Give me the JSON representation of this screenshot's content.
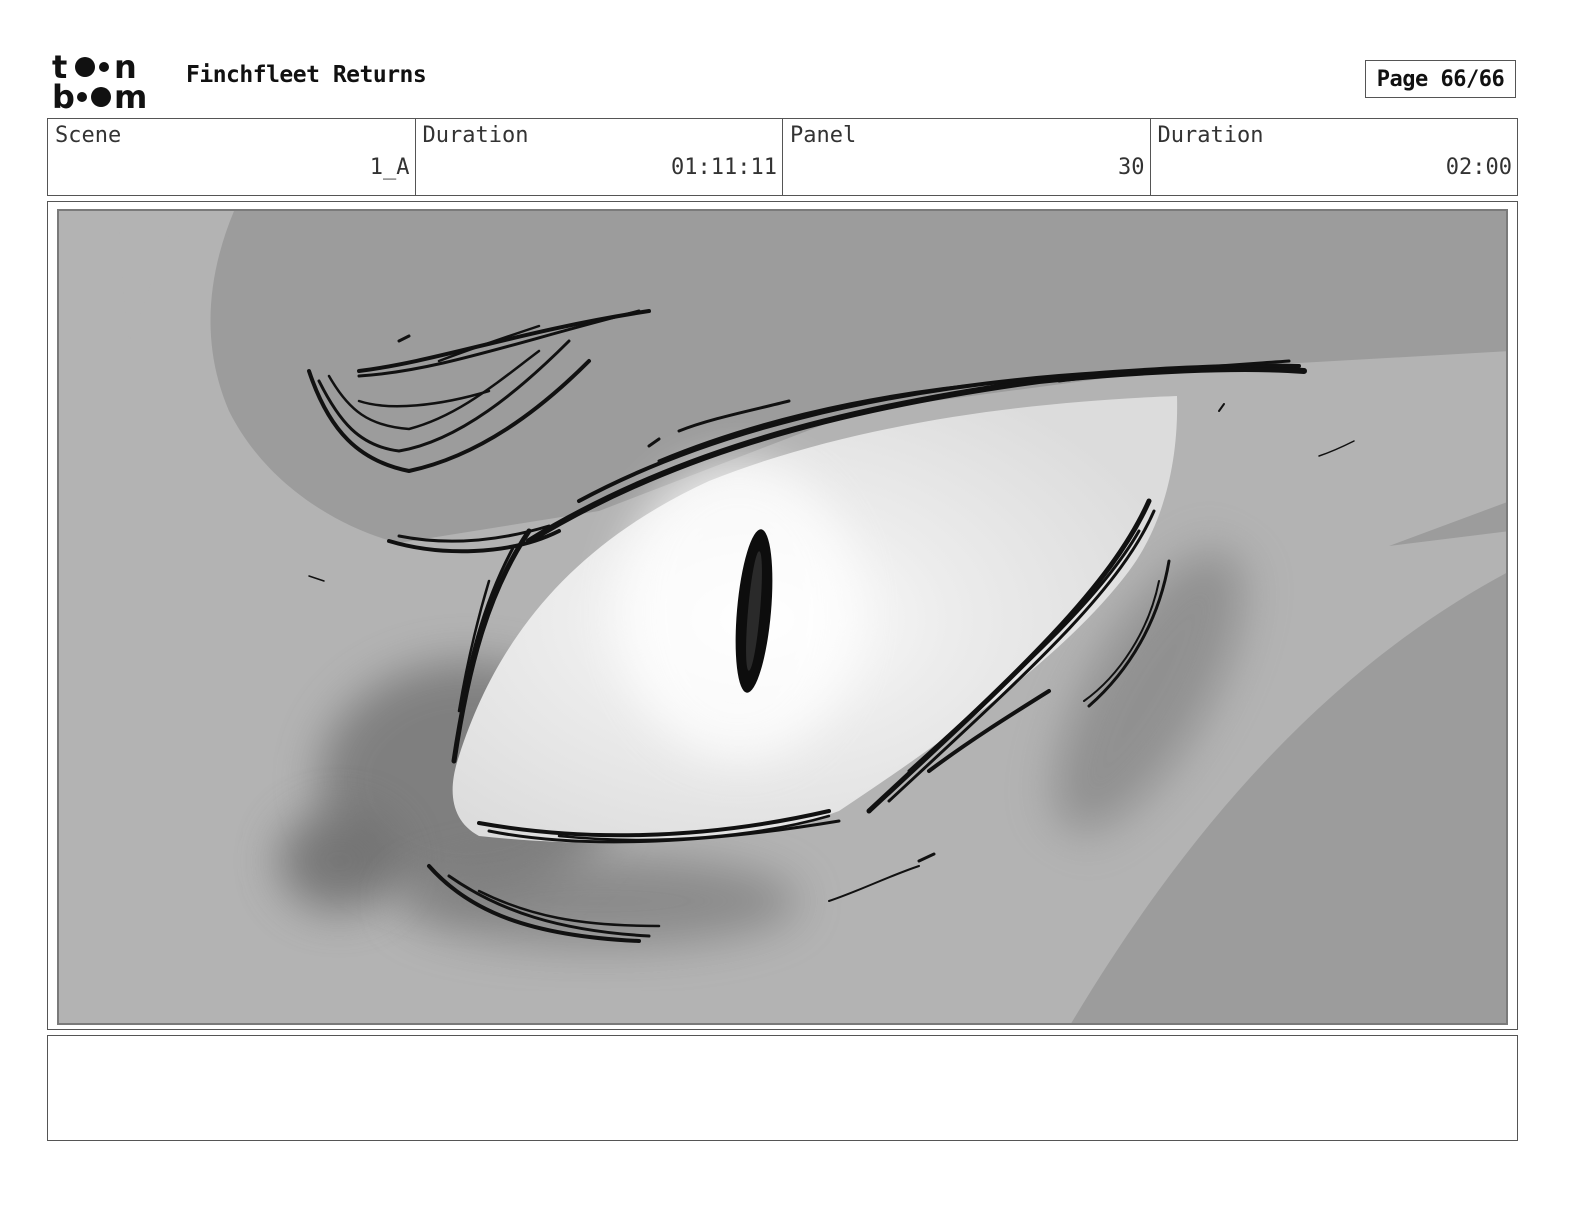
{
  "header": {
    "logo_top": "t o n",
    "logo_bottom": "b m",
    "project_title": "Finchfleet Returns",
    "page_label": "Page 66/66"
  },
  "info": {
    "scene_label": "Scene",
    "scene_value": "1_A",
    "duration_label": "Duration",
    "duration_value": "01:11:11",
    "panel_label": "Panel",
    "panel_value": "30",
    "panel_duration_label": "Duration",
    "panel_duration_value": "02:00"
  },
  "caption": {
    "text": ""
  },
  "colors": {
    "frame_border": "#555555",
    "sketch_ink": "#111111",
    "eye_white": "#e6e6e6",
    "background_dark": "#9c9c9c",
    "background_light": "#b3b3b3"
  }
}
